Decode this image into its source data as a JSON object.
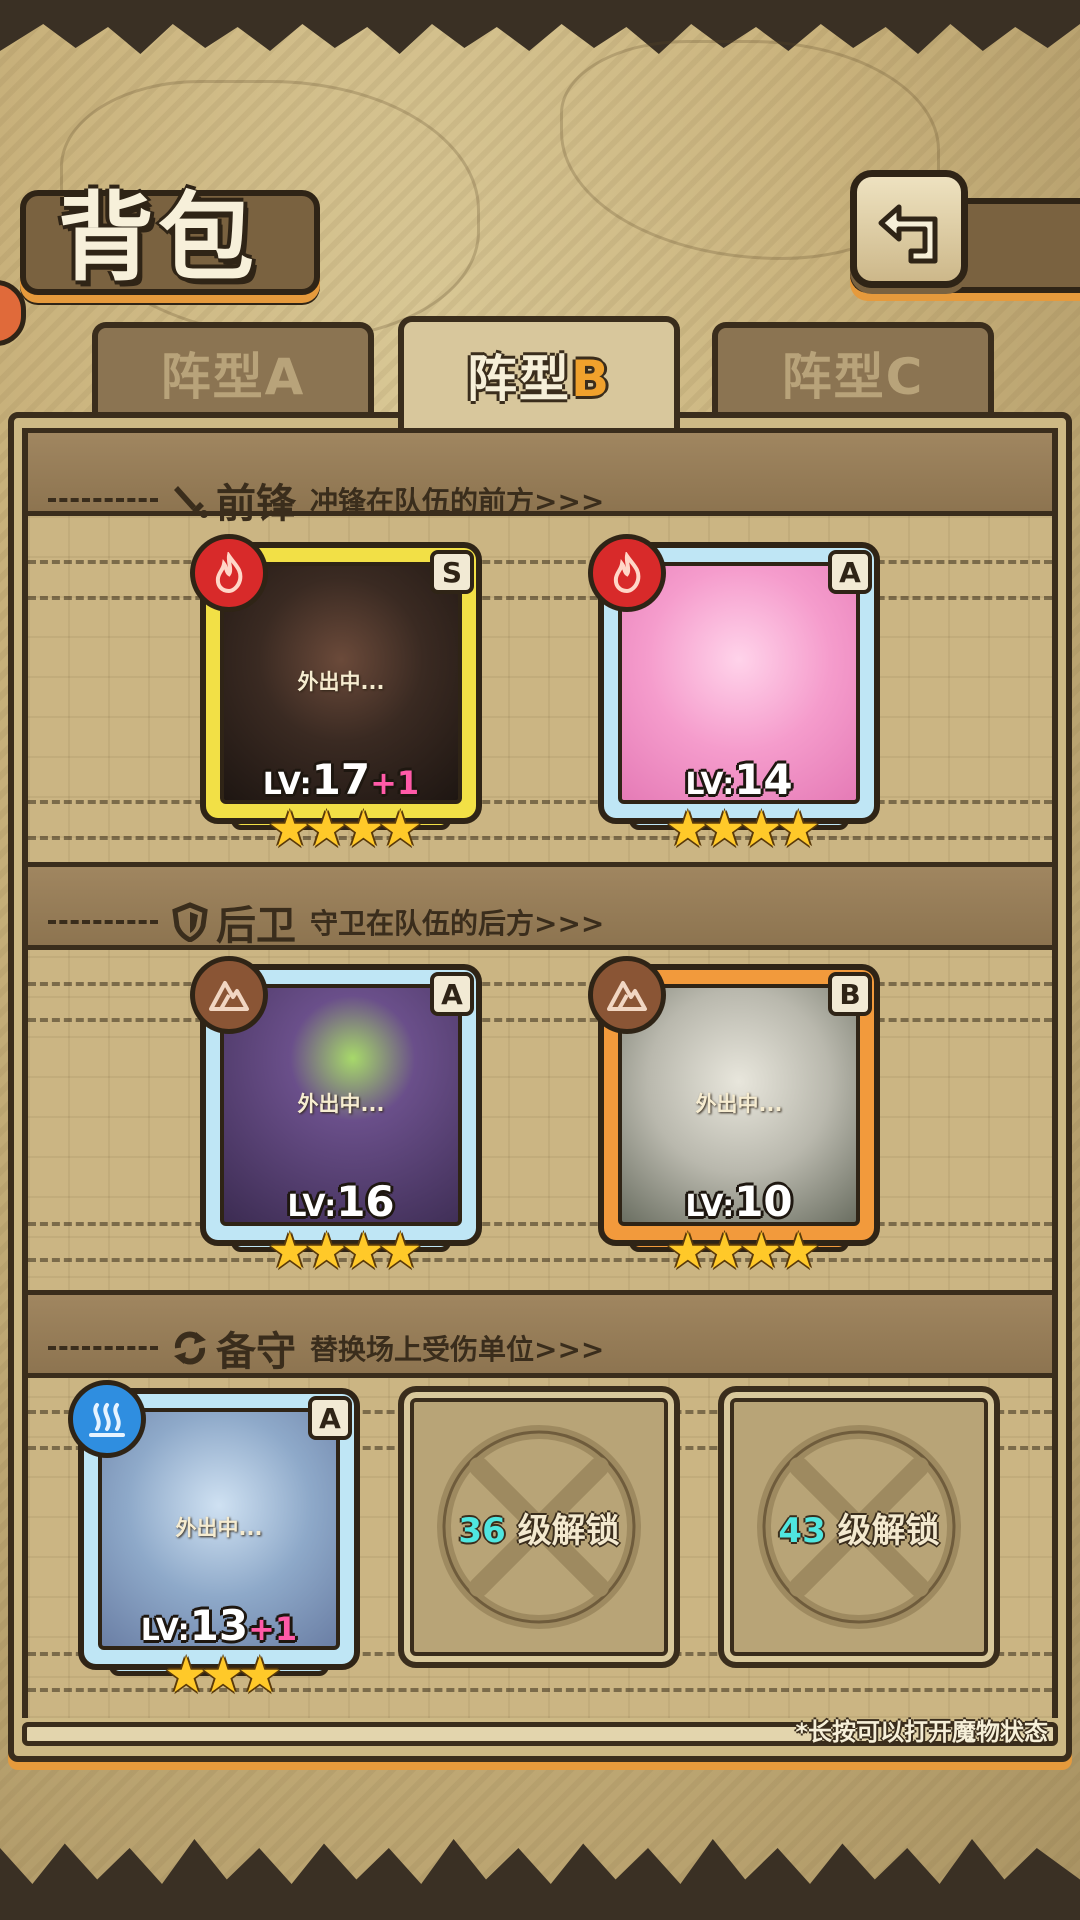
{
  "header": {
    "title": "背包"
  },
  "tabs": [
    {
      "label": "阵型",
      "letter": "A",
      "active": false
    },
    {
      "label": "阵型",
      "letter": "B",
      "active": true
    },
    {
      "label": "阵型",
      "letter": "C",
      "active": false
    }
  ],
  "sections": {
    "front": {
      "title": "前锋",
      "subtitle": "冲锋在队伍的前方>>>",
      "icon": "sword-icon"
    },
    "back": {
      "title": "后卫",
      "subtitle": "守卫在队伍的后方>>>",
      "icon": "shield-icon"
    },
    "reserve": {
      "title": "备守",
      "subtitle": "替换场上受伤单位>>>",
      "icon": "swap-icon"
    }
  },
  "units": [
    {
      "slot": "front-1",
      "rank": "S",
      "element": "fire-icon",
      "status": "外出中...",
      "lv_prefix": "LV:",
      "level": "17",
      "bonus": "+1",
      "stars": 4,
      "frame_color": "#f2e046",
      "art": "dark-warrior"
    },
    {
      "slot": "front-2",
      "rank": "A",
      "element": "fire-icon",
      "status": "",
      "lv_prefix": "LV:",
      "level": "14",
      "bonus": "",
      "stars": 4,
      "frame_color": "#bfe6f5",
      "art": "pink-slime-girl"
    },
    {
      "slot": "back-1",
      "rank": "A",
      "element": "earth-icon",
      "status": "外出中...",
      "lv_prefix": "LV:",
      "level": "16",
      "bonus": "",
      "stars": 4,
      "frame_color": "#bfe6f5",
      "art": "purple-eye-beast"
    },
    {
      "slot": "back-2",
      "rank": "B",
      "element": "earth-icon",
      "status": "外出中...",
      "lv_prefix": "LV:",
      "level": "10",
      "bonus": "",
      "stars": 4,
      "frame_color": "#f29a3c",
      "art": "grey-horned-girl"
    },
    {
      "slot": "reserve-1",
      "rank": "A",
      "element": "water-icon",
      "status": "外出中...",
      "lv_prefix": "LV:",
      "level": "13",
      "bonus": "+1",
      "stars": 3,
      "frame_color": "#bfe6f5",
      "art": "blue-catgirl"
    }
  ],
  "locked_slots": [
    {
      "level": "36",
      "label": "级解锁"
    },
    {
      "level": "43",
      "label": "级解锁"
    }
  ],
  "footer": {
    "hint": "*长按可以打开魔物状态"
  },
  "colors": {
    "accent_orange": "#e69a3c",
    "level_plus": "#ff5aa8",
    "unlock_level": "#4fe6e0",
    "fire": "#d82a2a",
    "earth": "#8a5535",
    "water": "#2f8ee0"
  }
}
